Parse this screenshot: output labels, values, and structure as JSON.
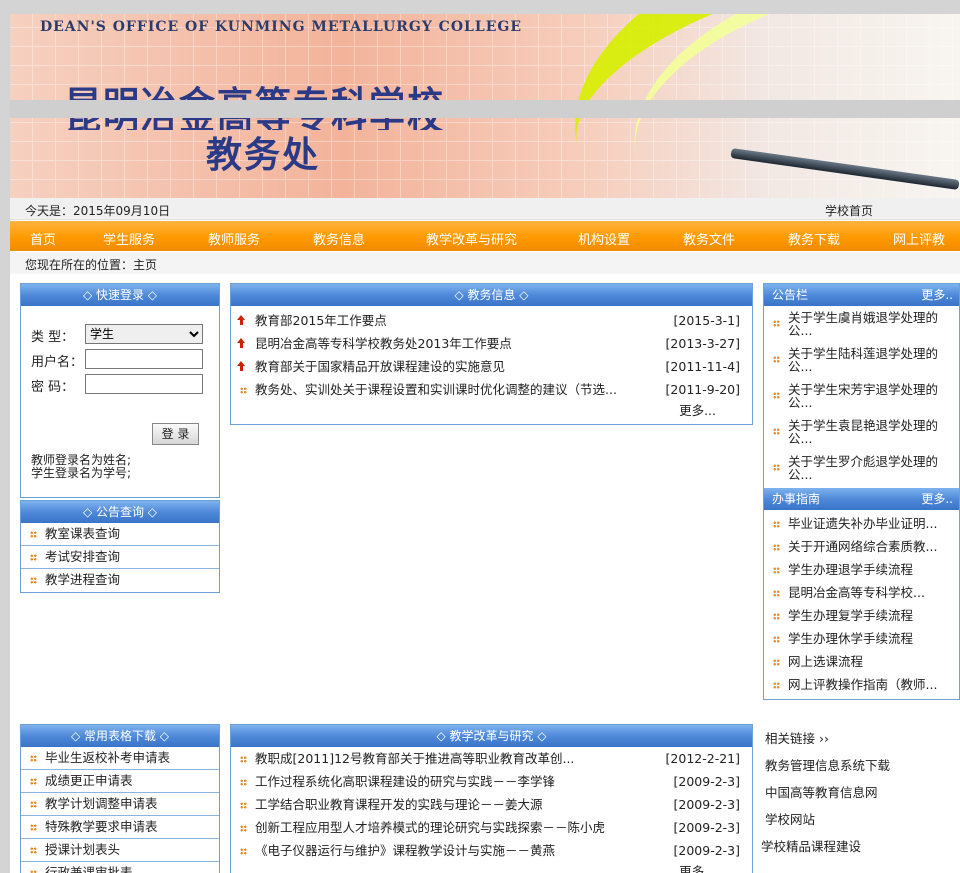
{
  "banner": {
    "english_title": "DEAN'S OFFICE OF KUNMING METALLURGY COLLEGE",
    "chinese_title": "昆明冶金高等专科学校",
    "chinese_subtitle": "教务处"
  },
  "datebar": {
    "today": "今天是：2015年09月10日",
    "home_link": "学校首页"
  },
  "nav": [
    "首页",
    "学生服务",
    "教师服务",
    "教务信息",
    "教学改革与研究",
    "机构设置",
    "教务文件",
    "教务下载",
    "网上评教"
  ],
  "location": "您现在所在的位置：主页",
  "login": {
    "title": "◇ 快速登录 ◇",
    "type_label": "类  型：",
    "type_value": "学生",
    "user_label": "用户名：",
    "pass_label": "密  码：",
    "button": "登 录",
    "tip1": "教师登录名为姓名;",
    "tip2": "学生登录名为学号;"
  },
  "notice_query": {
    "title": "◇ 公告查询 ◇",
    "items": [
      "教室课表查询",
      "考试安排查询",
      "教学进程查询"
    ]
  },
  "jwxx": {
    "title": "◇ 教务信息 ◇",
    "items": [
      {
        "text": "教育部2015年工作要点",
        "date": "[2015-3-1]",
        "hot": true
      },
      {
        "text": "昆明冶金高等专科学校教务处2013年工作要点",
        "date": "[2013-3-27]",
        "hot": true
      },
      {
        "text": "教育部关于国家精品开放课程建设的实施意见",
        "date": "[2011-11-4]",
        "hot": true
      },
      {
        "text": "教务处、实训处关于课程设置和实训课时优化调整的建议（节选...",
        "date": "[2011-9-20]",
        "hot": false
      }
    ],
    "more": "更多..."
  },
  "bulletin": {
    "title": "公告栏",
    "more": "更多..",
    "items": [
      "关于学生虞肖娥退学处理的公...",
      "关于学生陆科莲退学处理的公...",
      "关于学生宋芳宇退学处理的公...",
      "关于学生袁昆艳退学处理的公...",
      "关于学生罗介彪退学处理的公..."
    ]
  },
  "guide": {
    "title": "办事指南",
    "more": "更多..",
    "items": [
      "毕业证遗失补办毕业证明...",
      "关于开通网络综合素质教...",
      "学生办理退学手续流程",
      "昆明冶金高等专科学校...",
      "学生办理复学手续流程",
      "学生办理休学手续流程",
      "网上选课流程",
      "网上评教操作指南（教师..."
    ]
  },
  "forms": {
    "title": "◇ 常用表格下载 ◇",
    "items": [
      "毕业生返校补考申请表",
      "成绩更正申请表",
      "教学计划调整申请表",
      "特殊教学要求申请表",
      "授课计划表头",
      "行政兼课审批表"
    ]
  },
  "reform": {
    "title": "◇ 教学改革与研究 ◇",
    "items": [
      {
        "text": "教职成[2011]12号教育部关于推进高等职业教育改革创...",
        "date": "[2012-2-21]"
      },
      {
        "text": "工作过程系统化高职课程建设的研究与实践－－李学锋",
        "date": "[2009-2-3]"
      },
      {
        "text": "工学结合职业教育课程开发的实践与理论－－姜大源",
        "date": "[2009-2-3]"
      },
      {
        "text": "创新工程应用型人才培养模式的理论研究与实践探索－－陈小虎",
        "date": "[2009-2-3]"
      },
      {
        "text": "《电子仪器运行与维护》课程教学设计与实施－－黄燕",
        "date": "[2009-2-3]"
      }
    ],
    "more": "更多..."
  },
  "links": {
    "title": "相关链接 ››",
    "items": [
      "教务管理信息系统下载",
      "中国高等教育信息网",
      "学校网站",
      "学校精品课程建设"
    ]
  }
}
